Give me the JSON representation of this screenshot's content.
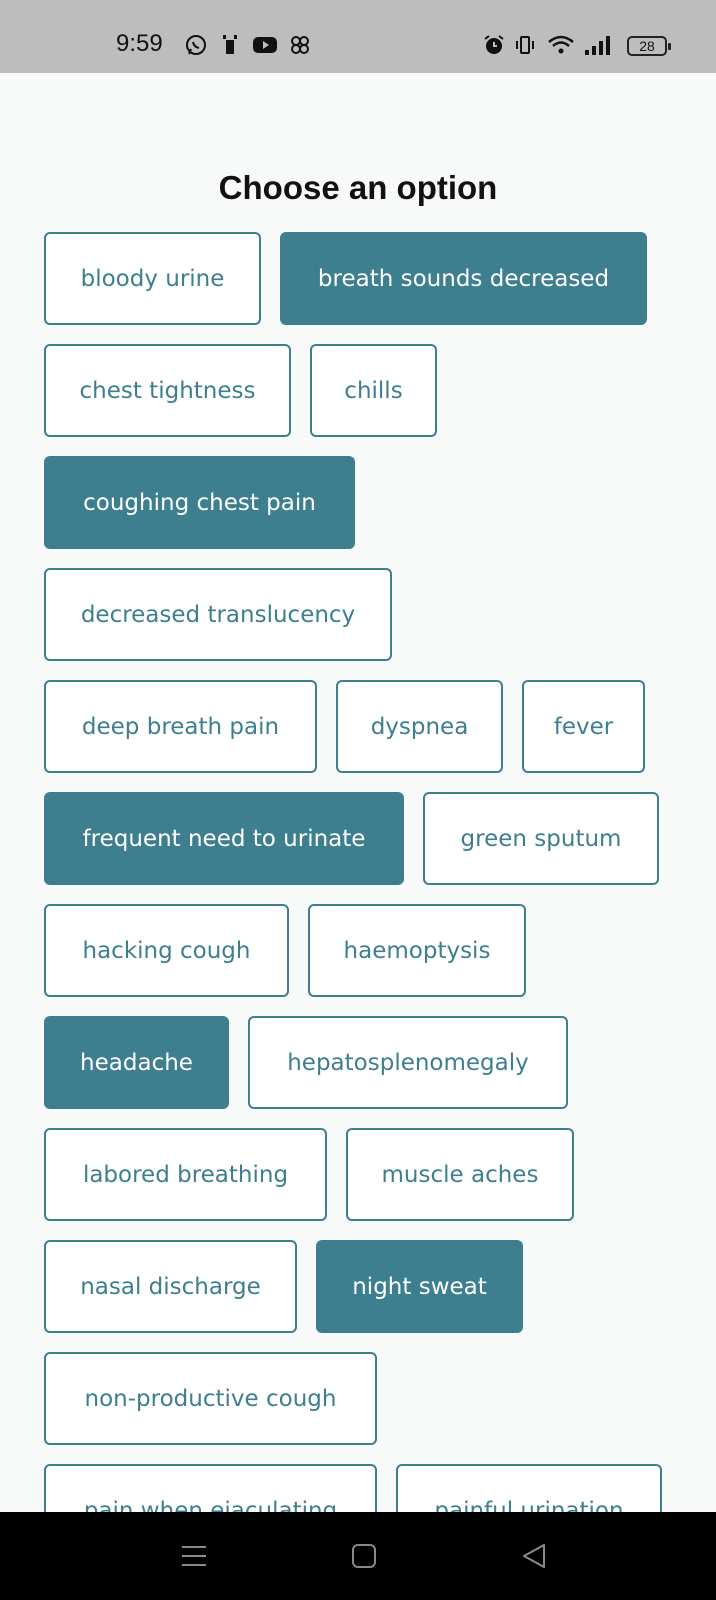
{
  "status_bar": {
    "time": "9:59",
    "battery": "28",
    "icons": [
      "whatsapp-icon",
      "sim-icon",
      "youtube-icon",
      "pinwheel-icon",
      "alarm-icon",
      "vibrate-icon",
      "wifi-icon",
      "signal-icon"
    ]
  },
  "title": "Choose an option",
  "colors": {
    "accent": "#3d7f8f",
    "background": "#f8f9f9",
    "chip_bg": "#ffffff"
  },
  "options": [
    {
      "label": "bloody urine",
      "selected": false
    },
    {
      "label": "breath sounds decreased",
      "selected": true
    },
    {
      "label": "chest tightness",
      "selected": false
    },
    {
      "label": "chills",
      "selected": false
    },
    {
      "label": "coughing chest pain",
      "selected": true
    },
    {
      "label": "decreased translucency",
      "selected": false
    },
    {
      "label": "deep breath pain",
      "selected": false
    },
    {
      "label": "dyspnea",
      "selected": false
    },
    {
      "label": "fever",
      "selected": false
    },
    {
      "label": "frequent need to urinate",
      "selected": true
    },
    {
      "label": "green sputum",
      "selected": false
    },
    {
      "label": "hacking cough",
      "selected": false
    },
    {
      "label": "haemoptysis",
      "selected": false
    },
    {
      "label": "headache",
      "selected": true
    },
    {
      "label": "hepatosplenomegaly",
      "selected": false
    },
    {
      "label": "labored breathing",
      "selected": false
    },
    {
      "label": "muscle aches",
      "selected": false
    },
    {
      "label": "nasal discharge",
      "selected": false
    },
    {
      "label": "night sweat",
      "selected": true
    },
    {
      "label": "non-productive cough",
      "selected": false
    },
    {
      "label": "pain when ejaculating",
      "selected": false
    },
    {
      "label": "painful urination",
      "selected": false
    }
  ],
  "nav": {
    "icons": [
      "menu-icon",
      "home-icon",
      "back-icon"
    ]
  }
}
